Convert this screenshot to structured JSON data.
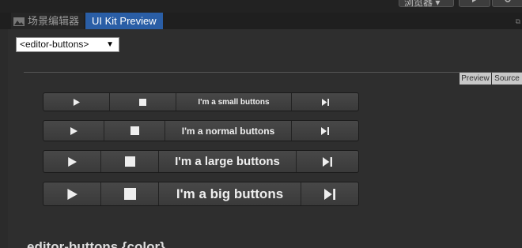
{
  "toolbar": {
    "browser_dropdown": "浏览器 ▾",
    "play_icon": "play-icon",
    "refresh_icon": "refresh-icon"
  },
  "tabs": [
    {
      "label": "场景编辑器",
      "icon": "scene-icon",
      "active": false
    },
    {
      "label": "UI Kit Preview",
      "active": true
    }
  ],
  "selector": {
    "value": "<editor-buttons>",
    "caret": "▼"
  },
  "view_tabs": {
    "preview": "Preview",
    "source": "Source"
  },
  "button_groups": [
    {
      "size": "small",
      "label": "I'm a small buttons"
    },
    {
      "size": "normal",
      "label": "I'm a normal buttons"
    },
    {
      "size": "large",
      "label": "I'm a large buttons"
    },
    {
      "size": "big",
      "label": "I'm a big buttons"
    }
  ],
  "section_heading": "editor-buttons {color}",
  "colors": {
    "active_tab": "#2a5ea6",
    "background": "#2b2b2b"
  }
}
